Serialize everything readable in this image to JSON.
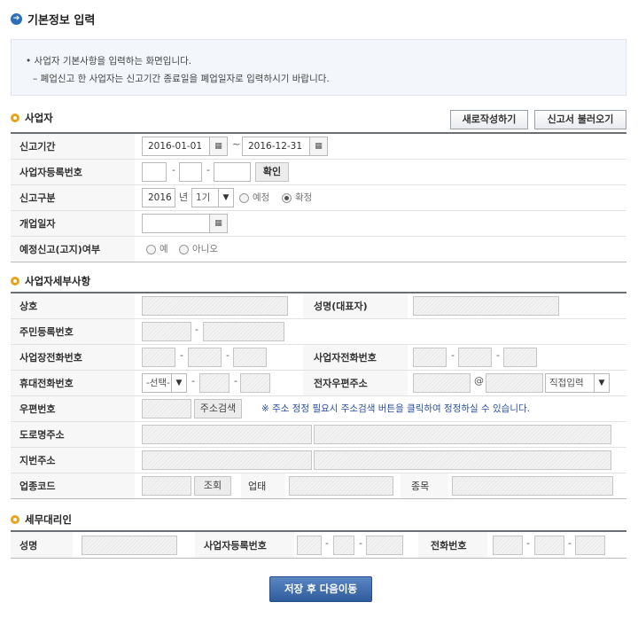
{
  "page": {
    "title": "기본정보 입력",
    "title_icon": "arrow-right-circle-icon"
  },
  "notice": {
    "line1": "• 사업자 기본사항을 입력하는 화면입니다.",
    "line2": "– 폐업신고 한 사업자는 신고기간 종료일을 폐업일자로 입력하시기 바랍니다."
  },
  "buttons": {
    "new": "새로작성하기",
    "load": "신고서 불러오기",
    "confirm": "확인",
    "address_search": "주소검색",
    "lookup": "조회",
    "save_next": "저장 후 다음이동"
  },
  "section_business": {
    "title": "사업자",
    "period_label": "신고기간",
    "period_start": "2016-01-01",
    "period_tilde": "~",
    "period_end": "2016-12-31",
    "regno_label": "사업자등록번호",
    "report_type_label": "신고구분",
    "year_value": "2016",
    "year_unit": "년",
    "term_value": "1기",
    "radio_scheduled": "예정",
    "radio_final": "확정",
    "selected_type": "확정",
    "open_date_label": "개업일자",
    "notice_label": "예정신고(고지)여부",
    "radio_yes": "예",
    "radio_no": "아니오"
  },
  "section_detail": {
    "title": "사업자세부사항",
    "company_label": "상호",
    "ceo_label": "성명(대표자)",
    "resident_label": "주민등록번호",
    "biz_phone_label": "사업장전화번호",
    "owner_phone_label": "사업자전화번호",
    "mobile_label": "휴대전화번호",
    "mobile_select": "-선택-",
    "email_label": "전자우편주소",
    "email_at": "@",
    "email_domain_select": "직접입력",
    "zip_label": "우편번호",
    "zip_note": "※ 주소 정정 필요시 주소검색 버튼을 클릭하여 정정하실 수 있습니다.",
    "road_addr_label": "도로명주소",
    "lot_addr_label": "지번주소",
    "industry_label": "업종코드",
    "business_type_label": "업태",
    "item_label": "종목"
  },
  "section_agent": {
    "title": "세무대리인",
    "name_label": "성명",
    "regno_label": "사업자등록번호",
    "phone_label": "전화번호"
  },
  "separators": {
    "dash": "-"
  },
  "colors": {
    "primary_button": "#2f5c9c",
    "section_icon": "#e8a31c",
    "note_text": "#2a4f9c",
    "notice_bg": "#f3f6fb"
  }
}
